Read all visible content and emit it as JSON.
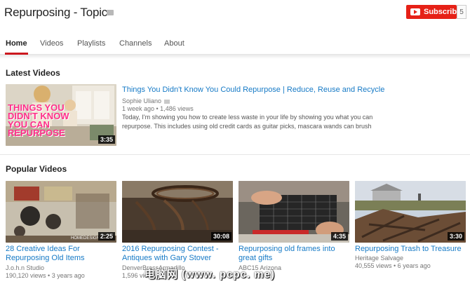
{
  "header": {
    "title": "Repurposing - Topic",
    "subscribe_label": "Subscribe",
    "subscriber_count": "5"
  },
  "tabs": [
    {
      "label": "Home",
      "active": true
    },
    {
      "label": "Videos"
    },
    {
      "label": "Playlists"
    },
    {
      "label": "Channels"
    },
    {
      "label": "About"
    }
  ],
  "latest": {
    "heading": "Latest Videos",
    "video": {
      "title": "Things You Didn't Know You Could Repurpose | Reduce, Reuse and Recycle",
      "channel": "Sophie Uliano",
      "meta": "1 week ago • 1,486 views",
      "description_line1": "Today, I'm showing you how to create less waste in your life by showing you what you can",
      "description_line2": "repurpose. This includes using old credit cards as guitar picks, mascara wands can brush",
      "duration": "3:35",
      "thumb_text_1": "THINGS YOU",
      "thumb_text_2": "DIDN'T KNOW",
      "thumb_text_3": "YOU CAN",
      "thumb_text_4": "REPURPOSE"
    }
  },
  "popular": {
    "heading": "Popular Videos",
    "videos": [
      {
        "title_line1": "28 Creative Ideas For",
        "title_line2": "Repurposing Old Items",
        "channel": "J.o.h.n Studio",
        "meta": "190,120 views • 3 years ago",
        "duration": "2:25",
        "thumb_caption": "HOMEDESIGNS"
      },
      {
        "title_line1": "2016 Repurposing Contest -",
        "title_line2": "Antiques with Gary Stover",
        "channel": "DenverBrassArmadillo",
        "meta": "1,596 views",
        "duration": "30:08"
      },
      {
        "title_line1": "Repurposing old frames into",
        "title_line2": "great gifts",
        "channel": "ABC15 Arizona",
        "meta": "",
        "duration": "4:35"
      },
      {
        "title_line1": "Repurposing Trash to Treasure",
        "title_line2": "",
        "channel": "Heritage Salvage",
        "meta": "40,555 views • 6 years ago",
        "duration": "3:30"
      }
    ]
  },
  "watermark": "电脑网 (www. pcpc. me)",
  "colors": {
    "brand_red": "#e62117",
    "tab_underline": "#cc181e",
    "link_blue": "#167ac6"
  }
}
